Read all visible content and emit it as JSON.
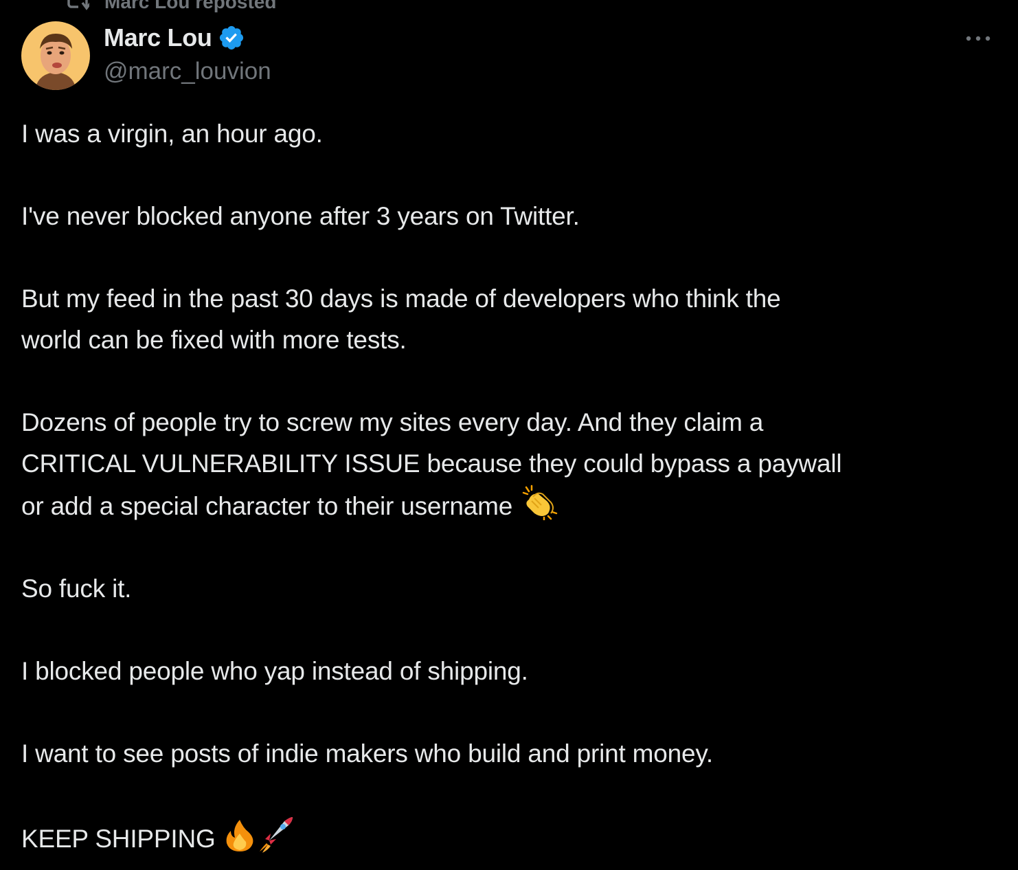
{
  "repost": {
    "label": "Marc Lou reposted",
    "icon": "repost-icon"
  },
  "author": {
    "display_name": "Marc Lou",
    "handle": "@marc_louvion",
    "verified": true,
    "verified_color": "#1d9bf0",
    "avatar_bg": "#f7c46c"
  },
  "tweet": {
    "paragraphs": [
      "I was a virgin, an hour ago.",
      "I've never blocked anyone after 3 years on Twitter.",
      "But my feed in the past 30 days is made of developers who think the",
      "world can be fixed with more tests.",
      "Dozens of people try to screw my sites every day. And they claim a",
      "CRITICAL VULNERABILITY ISSUE because they could bypass a paywall",
      "or add a special character to their username",
      "So fuck it.",
      "I blocked people who yap instead of shipping.",
      "I want to see posts of indie makers who build and print money.",
      "KEEP SHIPPING"
    ],
    "emojis": {
      "clap": "clapping-hands-emoji",
      "fire": "fire-emoji",
      "rocket": "rocket-emoji"
    }
  },
  "colors": {
    "background": "#000000",
    "text": "#e7e9ea",
    "secondary": "#71767b"
  }
}
